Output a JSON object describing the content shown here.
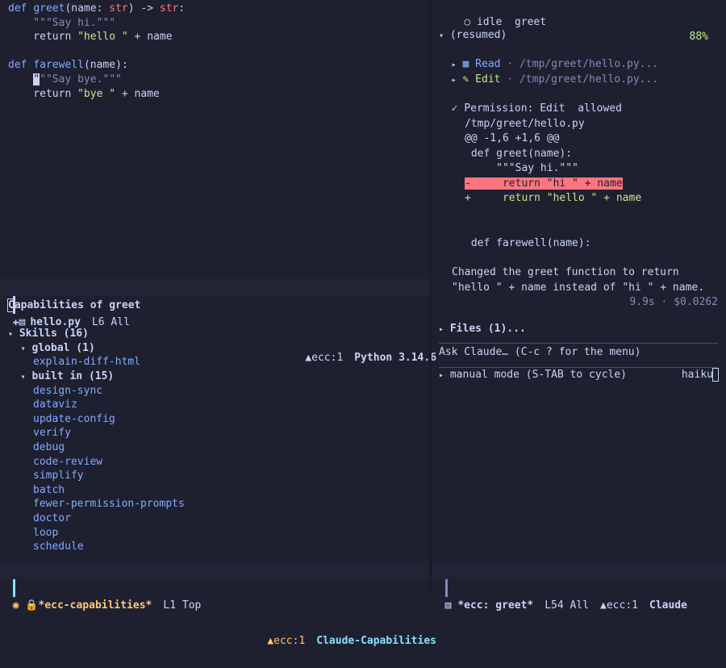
{
  "editor": {
    "lines": [
      {
        "parts": [
          [
            "kw",
            "def "
          ],
          [
            "fn",
            "greet"
          ],
          [
            "plain",
            "(name: "
          ],
          [
            "typ",
            "str"
          ],
          [
            "plain",
            ") -> "
          ],
          [
            "typ",
            "str"
          ],
          [
            "plain",
            ":"
          ]
        ]
      },
      {
        "parts": [
          [
            "doc",
            "    \"\"\"Say hi.\"\"\""
          ]
        ]
      },
      {
        "parts": [
          [
            "plain",
            "    return "
          ],
          [
            "str",
            "\"hello \""
          ],
          [
            "plain",
            " + name"
          ]
        ]
      },
      {
        "parts": [
          [
            "plain",
            ""
          ]
        ]
      },
      {
        "parts": [
          [
            "kw",
            "def "
          ],
          [
            "fn",
            "farewell"
          ],
          [
            "plain",
            "(name):"
          ]
        ]
      },
      {
        "parts": [
          [
            "plain",
            "    "
          ],
          [
            "cursor",
            "\""
          ],
          [
            "doc",
            "\"\"Say bye.\"\"\""
          ]
        ]
      },
      {
        "parts": [
          [
            "plain",
            "    return "
          ],
          [
            "str",
            "\"bye \""
          ],
          [
            "plain",
            " + name"
          ]
        ]
      }
    ]
  },
  "editor_modeline": {
    "filename": "hello.py",
    "position": "L6 All",
    "ecc": "ecc:1",
    "mode": "Python 3.14.6"
  },
  "capabilities": {
    "title": "Capabilities of greet",
    "skills_header": "Skills (16)",
    "global_header": "global (1)",
    "global_items": [
      "explain-diff-html"
    ],
    "builtin_header": "built in (15)",
    "builtin_items": [
      "design-sync",
      "dataviz",
      "update-config",
      "verify",
      "debug",
      "code-review",
      "simplify",
      "batch",
      "fewer-permission-prompts",
      "doctor",
      "loop",
      "schedule"
    ]
  },
  "caps_modeline": {
    "buffer": "*ecc-capabilities*",
    "position": "L1 Top",
    "ecc": "ecc:1",
    "mode": "Claude-Capabilities"
  },
  "chat": {
    "status": "idle",
    "session": "greet",
    "percent": "88%",
    "resumed": "(resumed)",
    "tool_read_label": "Read",
    "tool_read_path": "· /tmp/greet/hello.py...",
    "tool_edit_label": "Edit",
    "tool_edit_path": "· /tmp/greet/hello.py...",
    "permission": "Permission: Edit  allowed",
    "perm_path": "/tmp/greet/hello.py",
    "hunk": "@@ -1,6 +1,6 @@",
    "diff_ctx1": " def greet(name):",
    "diff_ctx2": "     \"\"\"Say hi.\"\"\"",
    "diff_del": "-     return \"hi \" + name",
    "diff_add": "+     return \"hello \" + name",
    "diff_ctx3": " def farewell(name):",
    "summary1": "Changed the greet function to return",
    "summary2": "\"hello \" + name instead of \"hi \" + name.",
    "meta": "9.9s · $0.0262",
    "files": "Files (1)...",
    "prompt_placeholder": "Ask Claude… (C-c ? for the menu)",
    "mode_line": "manual mode (S-TAB to cycle)",
    "model": "haiku"
  },
  "chat_modeline": {
    "buffer": "*ecc: greet*",
    "position": "L54 All",
    "ecc": "ecc:1",
    "mode": "Claude"
  },
  "colors": {
    "background": "#1e2030",
    "keyword": "#82aaff",
    "string": "#c3e88d",
    "type": "#ff757f",
    "accent_mode": "#86e1fc",
    "modeline_buffer": "#ffc777"
  }
}
